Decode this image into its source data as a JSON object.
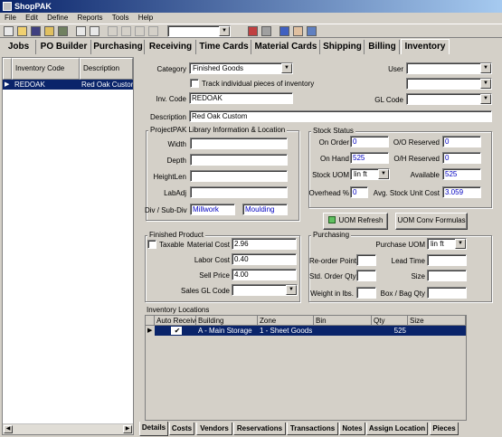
{
  "window": {
    "title": "ShopPAK"
  },
  "menu": [
    "File",
    "Edit",
    "Define",
    "Reports",
    "Tools",
    "Help"
  ],
  "tabs": [
    "Jobs",
    "PO Builder",
    "Purchasing",
    "Receiving",
    "Time Cards",
    "Material Cards",
    "Shipping",
    "Billing",
    "Inventory"
  ],
  "active_tab": "Inventory",
  "list": {
    "headers": [
      "Inventory Code",
      "Description"
    ],
    "rows": [
      {
        "code": "REDOAK",
        "description": "Red Oak Custom"
      }
    ]
  },
  "form": {
    "category_label": "Category",
    "category_value": "Finished Goods",
    "track_label": "Track individual pieces of inventory",
    "user_label": "User",
    "user_value": "",
    "extra_value": "",
    "inv_code_label": "Inv. Code",
    "inv_code_value": "REDOAK",
    "gl_code_label": "GL Code",
    "gl_code_value": "",
    "description_label": "Description",
    "description_value": "Red Oak Custom"
  },
  "library": {
    "title": "ProjectPAK Library Information & Location",
    "width_label": "Width",
    "depth_label": "Depth",
    "heightlen_label": "HeightLen",
    "labadj_label": "LabAdj",
    "div_label": "Div / Sub-Div",
    "div_value": "Millwork",
    "subdiv_value": "Moulding"
  },
  "stock": {
    "title": "Stock Status",
    "on_order_label": "On Order",
    "on_order_value": "0",
    "oo_reserved_label": "O/O Reserved",
    "oo_reserved_value": "0",
    "on_hand_label": "On Hand",
    "on_hand_value": "525",
    "oh_reserved_label": "O/H Reserved",
    "oh_reserved_value": "0",
    "stock_uom_label": "Stock UOM",
    "stock_uom_value": "lin ft",
    "available_label": "Available",
    "available_value": "525",
    "overhead_label": "Overhead  %",
    "overhead_value": "0",
    "avg_cost_label": "Avg. Stock Unit Cost",
    "avg_cost_value": "3.059",
    "uom_refresh": "UOM Refresh",
    "uom_conv": "UOM Conv Formulas"
  },
  "finished": {
    "title": "Finished Product",
    "taxable_label": "Taxable",
    "material_cost_label": "Material Cost",
    "material_cost_value": "2.96",
    "labor_cost_label": "Labor Cost",
    "labor_cost_value": "0.40",
    "sell_price_label": "Sell Price",
    "sell_price_value": "4.00",
    "sales_gl_label": "Sales GL Code",
    "sales_gl_value": ""
  },
  "purchasing": {
    "title": "Purchasing",
    "purchase_uom_label": "Purchase UOM",
    "purchase_uom_value": "lin ft",
    "reorder_label": "Re-order Point",
    "lead_time_label": "Lead Time",
    "std_order_label": "Std. Order Qty",
    "size_label": "Size",
    "weight_label": "Weight in lbs.",
    "box_label": "Box / Bag Qty"
  },
  "locations": {
    "title": "Inventory Locations",
    "headers": [
      "Auto Receive",
      "Building",
      "Zone",
      "Bin",
      "Qty",
      "Size"
    ],
    "rows": [
      {
        "auto": "✔",
        "building": "A - Main Storage",
        "zone": "1 - Sheet Goods",
        "bin": "",
        "qty": "525",
        "size": ""
      }
    ]
  },
  "bottom_tabs": [
    "Details",
    "Costs",
    "Vendors",
    "Reservations",
    "Transactions",
    "Notes",
    "Assign Location",
    "Pieces"
  ],
  "active_bottom_tab": "Details"
}
